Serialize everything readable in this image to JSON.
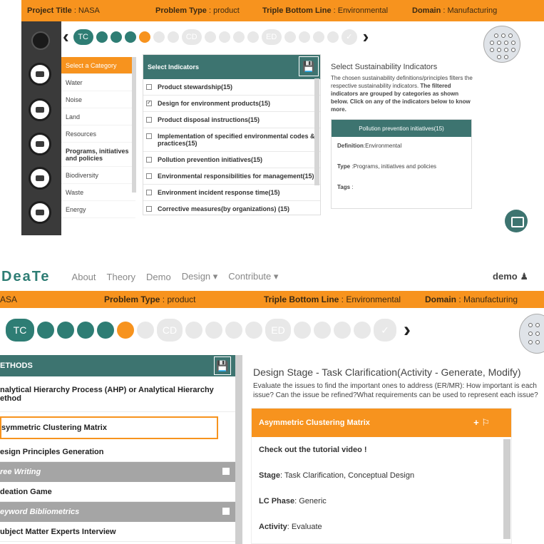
{
  "top": {
    "header": {
      "project_label": "Project Title",
      "project_value": " : NASA",
      "problem_label": "Problem Type",
      "problem_value": " : product",
      "tbl_label": "Triple Bottom Line",
      "tbl_value": " : Environmental",
      "domain_label": "Domain",
      "domain_value": " : Manufacturing"
    },
    "stepper": {
      "prev": "‹",
      "next": "›",
      "tc": "TC",
      "cd": "CD",
      "ed": "ED",
      "done": "✓"
    },
    "categories": {
      "header": "Select a Category",
      "items": [
        "Water",
        "Noise",
        "Land",
        "Resources",
        "Programs, initiatives and policies",
        "Biodiversity",
        "Waste",
        "Energy"
      ]
    },
    "indicators": {
      "header": "Select Indicators",
      "items": [
        {
          "label": "Product stewardship(15)",
          "checked": false
        },
        {
          "label": "Design for environment products(15)",
          "checked": true
        },
        {
          "label": "Product disposal instructions(15)",
          "checked": false
        },
        {
          "label": "Implementation of specified environmental codes & practices(15)",
          "checked": false
        },
        {
          "label": "Pollution prevention initiatives(15)",
          "checked": false
        },
        {
          "label": "Environmental responsibilities for management(15)",
          "checked": false
        },
        {
          "label": "Environment incident response time(15)",
          "checked": false
        },
        {
          "label": "Corrective measures(by organizations) (15)",
          "checked": false
        }
      ]
    },
    "info": {
      "title": "Select Sustainability Indicators",
      "text_plain": "The chosen sustainability definitions/principles filters the respective sustainability indicators.",
      "text_bold": " The filtered indicators are grouped by categories as shown below. Click on any of the indicators below to know more.",
      "card_title": "Pollution prevention initiatives(15)",
      "definition_label": "Definition",
      "definition_value": ":Environmental",
      "type_label": "Type",
      "type_value": " :Programs, initiatives and policies",
      "tags_label": "Tags",
      "tags_value": " :"
    }
  },
  "bottom": {
    "nav": {
      "brand": "DeaTe",
      "links": [
        "About",
        "Theory",
        "Demo",
        "Design ▾",
        "Contribute ▾"
      ],
      "user": "demo"
    },
    "header": {
      "project_value": "ASA",
      "problem_label": "Problem Type",
      "problem_value": " : product",
      "tbl_label": "Triple Bottom Line",
      "tbl_value": " : Environmental",
      "domain_label": "Domain",
      "domain_value": " : Manufacturing"
    },
    "stepper": {
      "tc": "TC",
      "cd": "CD",
      "ed": "ED",
      "done": "✓",
      "next": "›"
    },
    "methods": {
      "header": "ETHODS",
      "rows": [
        {
          "kind": "item",
          "label": "nalytical Hierarchy Process (AHP) or Analytical Hierarchy ethod"
        },
        {
          "kind": "selected",
          "label": "symmetric Clustering Matrix"
        },
        {
          "kind": "item",
          "label": "esign Principles Generation"
        },
        {
          "kind": "group",
          "label": "ree Writing"
        },
        {
          "kind": "item",
          "label": "deation Game"
        },
        {
          "kind": "group",
          "label": "eyword Bibliometrics"
        },
        {
          "kind": "item",
          "label": "ubject Matter Experts Interview"
        }
      ]
    },
    "design": {
      "title": "Design Stage - Task Clarification(Activity - Generate, Modify)",
      "text": "Evaluate the issues to find the important ones to address (ER/MR): How important is each issue? Can the issue be refined?What requirements can be used to represent each issue?",
      "card_title": "Asymmetric Clustering Matrix",
      "card_actions": "+ ⚐",
      "tutorial": "Check out the tutorial video !",
      "stage_label": "Stage",
      "stage_value": " : Task Clarification, Conceptual Design",
      "lc_label": "LC Phase",
      "lc_value": " : Generic",
      "activity_label": "Activity",
      "activity_value": ": Evaluate"
    }
  }
}
